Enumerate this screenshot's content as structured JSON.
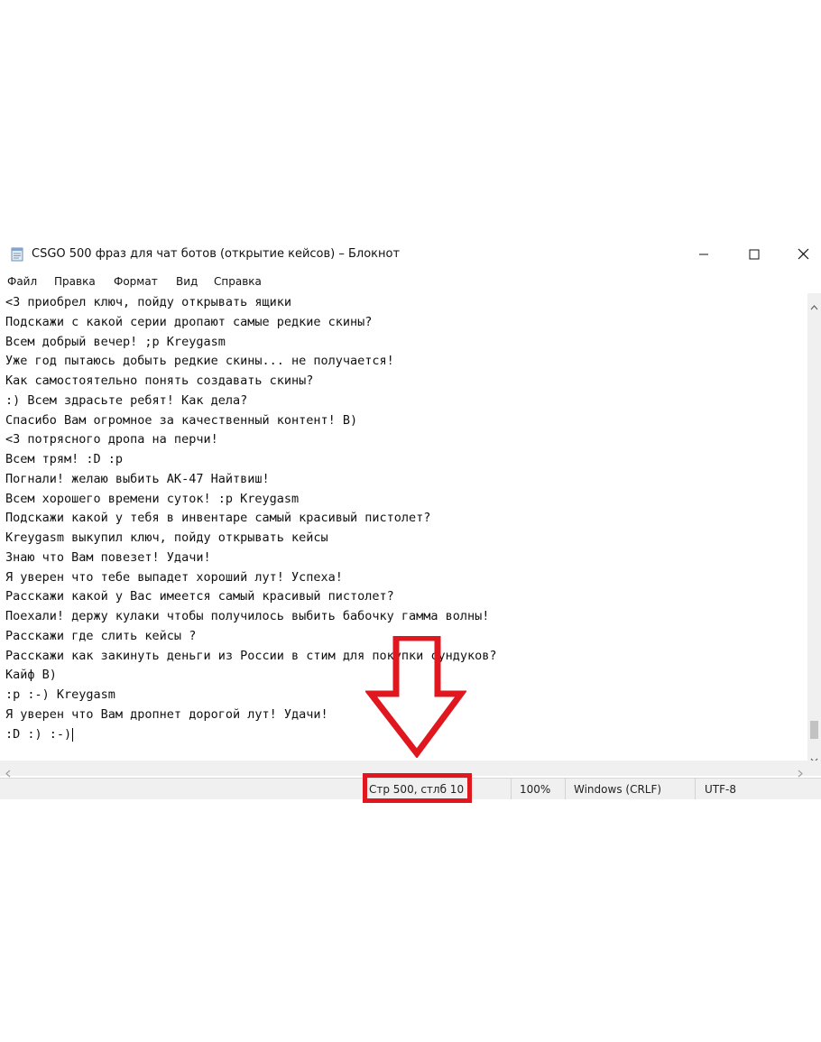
{
  "window": {
    "title": "CSGO 500 фраз для чат ботов (открытие кейсов) – Блокнот",
    "app_icon": "notepad-icon",
    "controls": [
      "minimize-icon",
      "maximize-icon",
      "close-icon"
    ]
  },
  "menu": [
    "Файл",
    "Правка",
    "Формат",
    "Вид",
    "Справка"
  ],
  "editor": {
    "lines": [
      "<3 приобрел ключ, пойду открывать ящики",
      "Подскажи с какой серии дропают самые редкие скины?",
      "Всем добрый вечер! ;p Kreygasm",
      "Уже год пытаюсь добыть редкие скины... не получается!",
      "Как самостоятельно понять создавать скины?",
      ":) Всем здрасьте ребят! Как дела?",
      "Спасибо Вам огромное за качественный контент! B)",
      "<3 потрясного дропа на перчи!",
      "Всем трям! :D :p",
      "Погнали! желаю выбить АК-47 Найтвиш!",
      "Всем хорошего времени суток! :p Kreygasm",
      "Подскажи какой у тебя в инвентаре самый красивый пистолет?",
      "Kreygasm выкупил ключ, пойду открывать кейсы",
      "Знаю что Вам повезет! Удачи!",
      "Я уверен что тебе выпадет хороший лут! Успеха!",
      "Расскажи какой у Вас имеется самый красивый пистолет?",
      "Поехали! держу кулаки чтобы получилось выбить бабочку гамма волны!",
      "Расскажи где слить кейсы ?",
      "Расскажи как закинуть деньги из России в стим для покупки сундуков?",
      "Кайф B)",
      ":p :-) Kreygasm",
      "Я уверен что Вам дропнет дорогой лут! Удачи!",
      ":D :) :-)"
    ]
  },
  "status": {
    "position": "Стр 500, стлб 10",
    "zoom": "100%",
    "line_ending": "Windows (CRLF)",
    "encoding": "UTF-8"
  },
  "annotation": {
    "color": "#e0171f",
    "arrow_icon": "arrow-down-icon"
  }
}
